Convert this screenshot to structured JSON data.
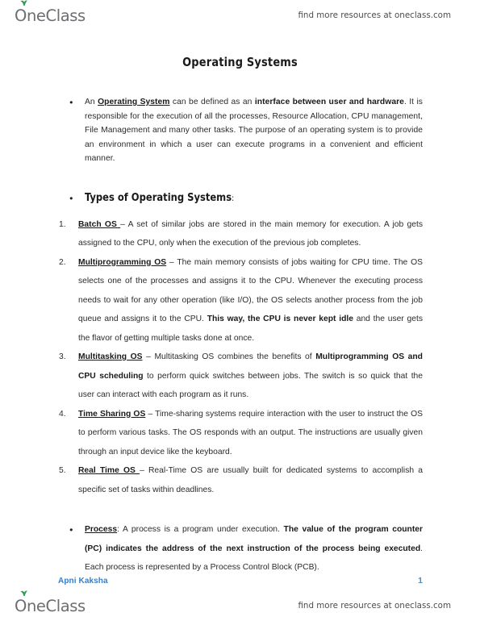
{
  "watermark": {
    "logo_text": "OneClass",
    "logo_icon": "oneclass-apple-logo",
    "leaf_color": "#2f9e52",
    "tagline": "find more resources at oneclass.com"
  },
  "document": {
    "title": "Operating Systems",
    "intro": {
      "part1": "An ",
      "term": "Operating System",
      "part2": " can be defined as an ",
      "bold": "interface between user and hardware",
      "part3": ". It is responsible for the execution of all the processes, Resource Allocation, CPU management, File Management and many other tasks. The purpose of an operating system is to provide an environment in which a user can execute programs in a convenient and efficient manner."
    },
    "section_heading": "Types of Operating Systems",
    "section_heading_colon": ":",
    "os_types": [
      {
        "term": "Batch OS ",
        "dash": "– ",
        "text": "A set of similar jobs are stored in the main memory for execution. A job gets assigned to the CPU, only when the execution of the previous job completes."
      },
      {
        "term": "Multiprogramming OS",
        "dash": " – ",
        "text_before_bold": "The main memory consists of jobs waiting for CPU time. The OS selects one of the processes and assigns it to the CPU. Whenever the executing process needs to wait for any other operation (like I/O), the OS selects another process from the job queue and assigns it to the CPU. ",
        "bold": "This way, the CPU is never kept idle",
        "text_after_bold": " and the user gets the flavor of getting multiple tasks done at once."
      },
      {
        "term": "Multitasking OS",
        "dash": " – ",
        "text_before_bold": "Multitasking OS combines the benefits of ",
        "bold": "Multiprogramming OS and CPU scheduling",
        "text_after_bold": " to perform quick switches between jobs. The switch is so quick that the user can interact with each program as it runs."
      },
      {
        "term": "Time Sharing OS",
        "dash": " – ",
        "text": "Time-sharing systems require interaction with the user to instruct the OS to perform various tasks. The OS responds with an output. The instructions are usually given through an input device like the keyboard."
      },
      {
        "term": "Real Time OS ",
        "dash": "– ",
        "text": "Real-Time OS are usually built for dedicated systems to accomplish a specific set of tasks within deadlines."
      }
    ],
    "process": {
      "term": "Process",
      "text1": ": A process is a program under execution. ",
      "bold": "The value of the program counter (PC) indicates the address of the next instruction of the process being executed",
      "text2": ". Each process is represented by a Process Control Block (PCB)."
    }
  },
  "footer": {
    "brand": "Apni Kaksha",
    "brand_color": "#3b7dc0",
    "page_number": "1"
  }
}
